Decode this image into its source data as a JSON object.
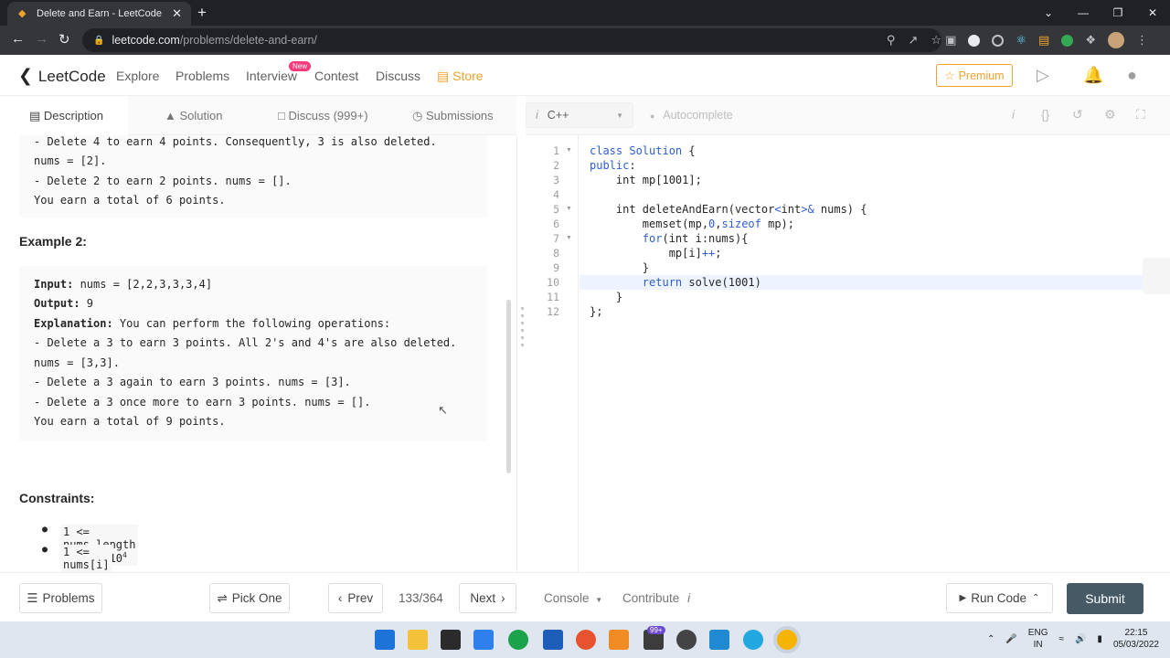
{
  "browser": {
    "tab_title": "Delete and Earn - LeetCode",
    "new_tab": "+",
    "url_domain": "leetcode.com",
    "url_path": "/problems/delete-and-earn/"
  },
  "nav": {
    "logo": "LeetCode",
    "links": [
      "Explore",
      "Problems",
      "Interview",
      "Contest",
      "Discuss"
    ],
    "new_badge": "New",
    "store": "Store",
    "premium": "Premium"
  },
  "left_tabs": {
    "description": "Description",
    "solution": "Solution",
    "discuss": "Discuss (999+)",
    "submissions": "Submissions"
  },
  "description": {
    "example1_tail": [
      "- Delete 4 to earn 4 points. Consequently, 3 is also deleted.",
      "nums = [2].",
      "- Delete 2 to earn 2 points. nums = [].",
      "You earn a total of 6 points."
    ],
    "example2_title": "Example 2:",
    "example2": {
      "input_label": "Input:",
      "input_value": " nums = [2,2,3,3,3,4]",
      "output_label": "Output:",
      "output_value": " 9",
      "explanation_label": "Explanation:",
      "explanation_value": " You can perform the following operations:",
      "lines": [
        "- Delete a 3 to earn 3 points. All 2's and 4's are also deleted.",
        "nums = [3,3].",
        "- Delete a 3 again to earn 3 points. nums = [3].",
        "- Delete a 3 once more to earn 3 points. nums = [].",
        "You earn a total of 9 points."
      ]
    },
    "constraints_title": "Constraints:",
    "constraints": [
      {
        "text": "1 <= nums.length <= 2 * 10",
        "sup": "4"
      },
      {
        "text": "1 <= nums[i] <= 10",
        "sup": "4"
      }
    ]
  },
  "editor": {
    "language": "C++",
    "autocomplete": "Autocomplete",
    "line_numbers": [
      "1",
      "2",
      "3",
      "4",
      "5",
      "6",
      "7",
      "8",
      "9",
      "10",
      "11",
      "12"
    ]
  },
  "bottom": {
    "problems": "Problems",
    "pick_one": "Pick One",
    "prev": "Prev",
    "counter": "133/364",
    "next": "Next",
    "console": "Console",
    "contribute": "Contribute",
    "run_code": "Run Code",
    "submit": "Submit"
  },
  "taskbar": {
    "lang": "ENG",
    "region": "IN",
    "time": "22:15",
    "date": "05/03/2022",
    "badge": "99+"
  },
  "colors": {
    "accent_orange": "#f0a22e",
    "keyword_blue": "#2f5dd1",
    "submit_bg": "#455a64",
    "new_badge": "#f73b78"
  }
}
